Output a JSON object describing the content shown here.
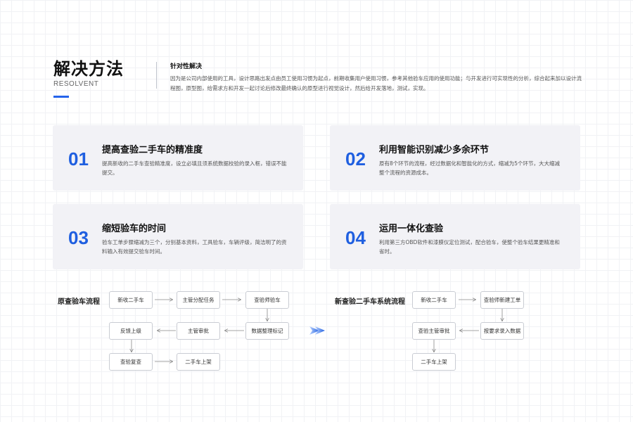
{
  "header": {
    "title": "解决方法",
    "subtitle": "RESOLVENT",
    "intro_heading": "针对性解决",
    "intro_text": "因为是公司内部使用的工具，设计思路出发点由员工使用习惯为起点，前期收集用户使用习惯，参考其他验车应用的使用功能；与开发进行可实现性的分析，综合起来加以设计流程图，原型图，给需求方和开发一起讨论后修改最终确认的原型进行视觉设计，然后给开发落地，测试，实现。"
  },
  "cards": [
    {
      "num": "01",
      "title": "提高查验二手车的精准度",
      "desc": "提高新收的二手车查验精准度，设立必填且须系统数据校验的录入框，错误不能提交。"
    },
    {
      "num": "02",
      "title": "利用智能识别减少多余环节",
      "desc": "原有8个环节的流程，经过数据化和智能化的方式，缩减为5个环节，大大缩减整个流程的资源成本。"
    },
    {
      "num": "03",
      "title": "缩短验车的时间",
      "desc": "验车工单步骤缩减为三个，分别基本资料，工具验车，车辆评级，简洁明了的资料输入有效提交验车时间。"
    },
    {
      "num": "04",
      "title": "运用一体化查验",
      "desc": "利用第三方OBD软件和漆膜仪定位测试，配合验车，使整个验车结果更精准和省时。"
    }
  ],
  "old_flow": {
    "label": "原查验车流程",
    "nodes": [
      "新收二手车",
      "主管分配任务",
      "查验师验车",
      "数据整理标记",
      "主管审批",
      "反馈上级",
      "查验复查",
      "二手车上架"
    ]
  },
  "new_flow": {
    "label": "新查验二手车系统流程",
    "nodes": [
      "新收二手车",
      "查验师新建工单",
      "按要求录入数据",
      "查验主管审批",
      "二手车上架"
    ]
  },
  "colors": {
    "accent": "#2563eb",
    "number": "#1f5fe0",
    "card_bg": "#f2f2f6"
  },
  "icons": {
    "transition_arrow": "double-chevron-right-icon"
  }
}
